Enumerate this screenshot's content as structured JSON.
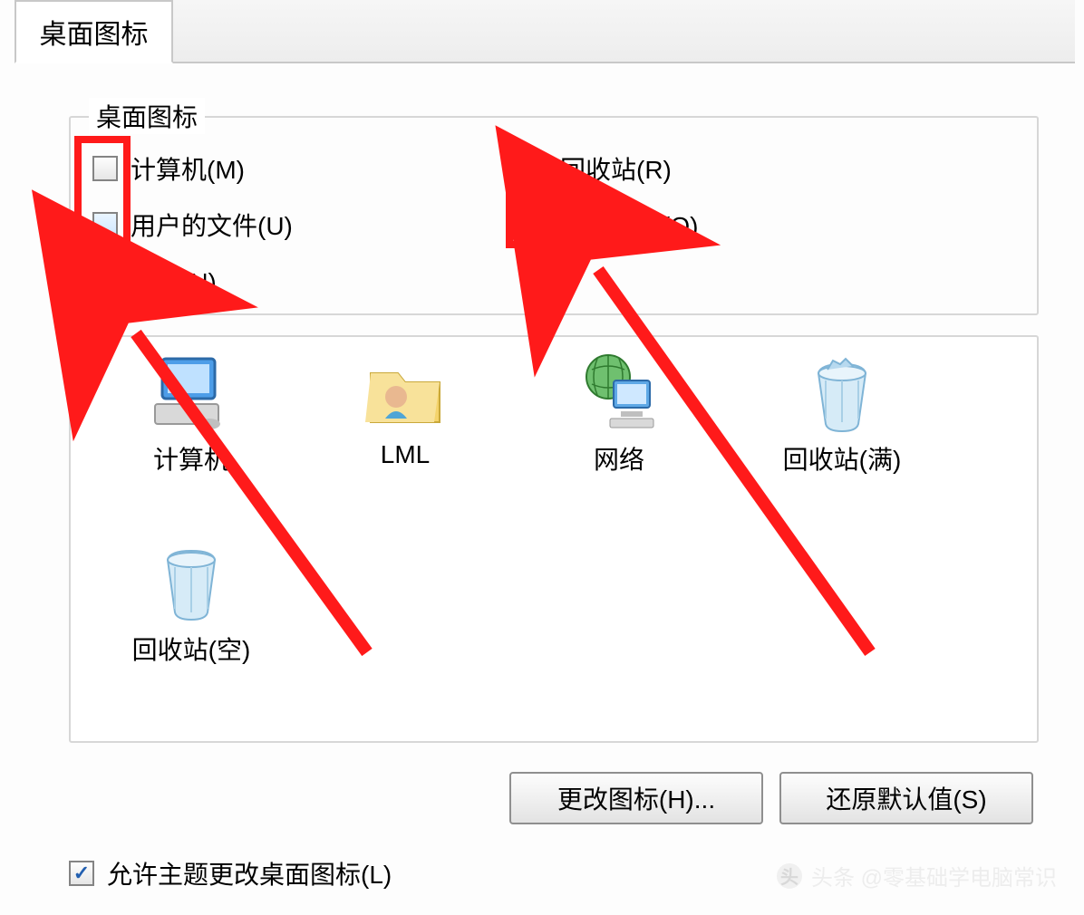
{
  "tab_label": "桌面图标",
  "group_title": "桌面图标",
  "checkboxes": {
    "computer": {
      "label": "计算机(M)",
      "checked": false
    },
    "userfiles": {
      "label": "用户的文件(U)",
      "checked": false
    },
    "network": {
      "label": "网络(N)",
      "checked": false
    },
    "recycle": {
      "label": "回收站(R)",
      "checked": true
    },
    "control": {
      "label": "控制面板(O)",
      "checked": false
    }
  },
  "icons": {
    "computer": "计算机",
    "user": "LML",
    "network": "网络",
    "recycle_full": "回收站(满)",
    "recycle_empty": "回收站(空)"
  },
  "buttons": {
    "change_icon": "更改图标(H)...",
    "restore_default": "还原默认值(S)"
  },
  "allow_themes_label": "允许主题更改桌面图标(L)",
  "allow_themes_checked": true,
  "watermark": "头条 @零基础学电脑常识"
}
